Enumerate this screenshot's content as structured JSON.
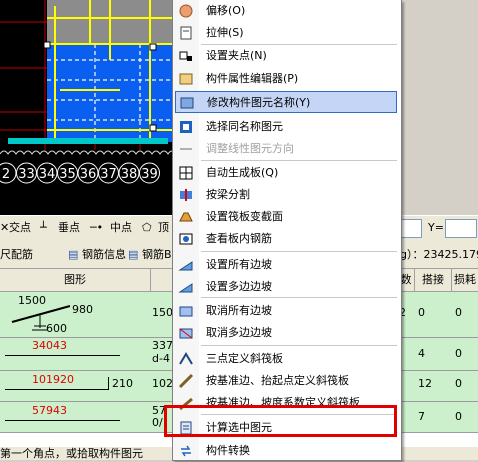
{
  "canvas": {
    "axis_labels": [
      "2",
      "33",
      "34",
      "35",
      "36",
      "37",
      "38",
      "39"
    ]
  },
  "snap_toolbar": {
    "items": [
      "交点",
      "垂点",
      "中点",
      "顶"
    ],
    "coord_label": "Y="
  },
  "rebar_toolbar": {
    "items": [
      "尺配筋",
      "钢筋信息",
      "钢筋B"
    ],
    "readout": "g）：23425.179"
  },
  "table": {
    "headers": {
      "shape": "图形",
      "count": "数",
      "lap": "搭接",
      "loss": "损耗"
    },
    "rows": [
      {
        "dims": [
          "1500",
          "980",
          "600"
        ],
        "len": "150",
        "count": "2",
        "lap": "0",
        "loss": "0"
      },
      {
        "value": "34043",
        "len": "337",
        "len2": "d-4",
        "count": "",
        "lap": "4",
        "loss": "0"
      },
      {
        "value": "101920",
        "side": "210",
        "len": "102",
        "count": "",
        "lap": "12",
        "loss": "0"
      },
      {
        "value": "57943",
        "len": "57",
        "len2": "0/",
        "count": "",
        "lap": "7",
        "loss": "0"
      }
    ]
  },
  "status": {
    "text": "第一个角点，或拾取构件图元"
  },
  "context_menu": {
    "items": [
      {
        "label": "偏移(O)",
        "icon": "offset-icon"
      },
      {
        "label": "拉伸(S)",
        "icon": "stretch-icon"
      },
      {
        "label": "设置夹点(N)",
        "icon": "grip-icon"
      },
      {
        "label": "构件属性编辑器(P)",
        "icon": "property-editor-icon"
      },
      {
        "label": "修改构件图元名称(Y)",
        "icon": "rename-icon",
        "selected": true
      },
      {
        "label": "选择同名称图元",
        "icon": "select-same-icon"
      },
      {
        "label": "调整线性图元方向",
        "icon": "direction-icon",
        "disabled": true
      },
      {
        "label": "自动生成板(Q)",
        "icon": "auto-slab-icon"
      },
      {
        "label": "按梁分割",
        "icon": "split-by-beam-icon"
      },
      {
        "label": "设置筏板变截面",
        "icon": "raft-section-icon"
      },
      {
        "label": "查看板内钢筋",
        "icon": "view-rebar-icon"
      },
      {
        "label": "设置所有边坡",
        "icon": "all-slope-icon"
      },
      {
        "label": "设置多边边坡",
        "icon": "multi-slope-icon"
      },
      {
        "label": "取消所有边坡",
        "icon": "cancel-all-slope-icon"
      },
      {
        "label": "取消多边边坡",
        "icon": "cancel-multi-slope-icon"
      },
      {
        "label": "三点定义斜筏板",
        "icon": "three-point-raft-icon"
      },
      {
        "label": "按基准边、抬起点定义斜筏板",
        "icon": "base-edge-lift-icon"
      },
      {
        "label": "按基准边、坡度系数定义斜筏板",
        "icon": "base-edge-slope-icon"
      },
      {
        "label": "计算选中图元",
        "icon": "calculate-icon"
      },
      {
        "label": "构件转换",
        "icon": "convert-icon"
      }
    ]
  },
  "colors": {
    "highlight_box": "#e00000",
    "menu_selected": "#c5d5f5",
    "row_bg": "#ccf0cc"
  }
}
